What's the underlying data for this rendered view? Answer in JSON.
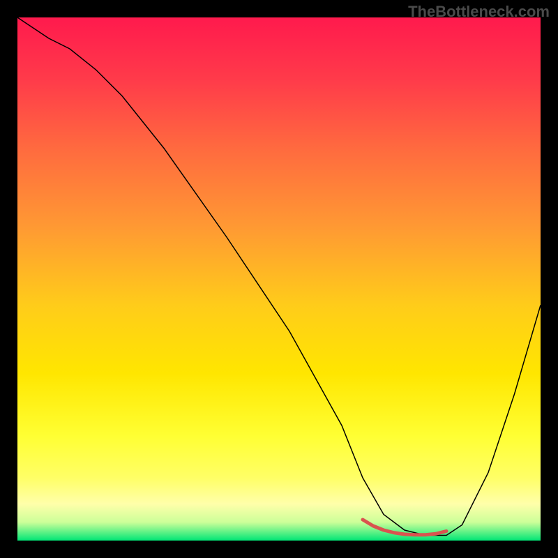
{
  "watermark": "TheBottleneck.com",
  "chart_data": {
    "type": "line",
    "title": "",
    "xlabel": "",
    "ylabel": "",
    "xlim": [
      0,
      100
    ],
    "ylim": [
      0,
      100
    ],
    "grid": false,
    "legend": false,
    "background": {
      "type": "vertical-gradient",
      "stops": [
        {
          "offset": 0.0,
          "color": "#ff1a4d"
        },
        {
          "offset": 0.12,
          "color": "#ff3b4a"
        },
        {
          "offset": 0.25,
          "color": "#ff6a3f"
        },
        {
          "offset": 0.4,
          "color": "#ff9933"
        },
        {
          "offset": 0.55,
          "color": "#ffcc1a"
        },
        {
          "offset": 0.68,
          "color": "#ffe600"
        },
        {
          "offset": 0.8,
          "color": "#ffff33"
        },
        {
          "offset": 0.88,
          "color": "#ffff66"
        },
        {
          "offset": 0.93,
          "color": "#ffffaa"
        },
        {
          "offset": 0.965,
          "color": "#ccff99"
        },
        {
          "offset": 1.0,
          "color": "#00e676"
        }
      ]
    },
    "series": [
      {
        "name": "bottleneck-curve",
        "stroke": "#000000",
        "stroke_width": 1.5,
        "x": [
          0,
          3,
          6,
          10,
          15,
          20,
          28,
          40,
          52,
          62,
          66,
          70,
          74,
          78,
          82,
          85,
          90,
          95,
          100
        ],
        "values": [
          100,
          98,
          96,
          94,
          90,
          85,
          75,
          58,
          40,
          22,
          12,
          5,
          2,
          1,
          1,
          3,
          13,
          28,
          45
        ]
      }
    ],
    "annotations": [
      {
        "name": "minimum-highlight",
        "type": "segment",
        "stroke": "#d9534f",
        "stroke_width": 5,
        "x": [
          66,
          68,
          70,
          72,
          74,
          76,
          78,
          80,
          82
        ],
        "values": [
          4.0,
          2.8,
          2.0,
          1.5,
          1.2,
          1.1,
          1.1,
          1.3,
          1.8
        ]
      }
    ]
  }
}
